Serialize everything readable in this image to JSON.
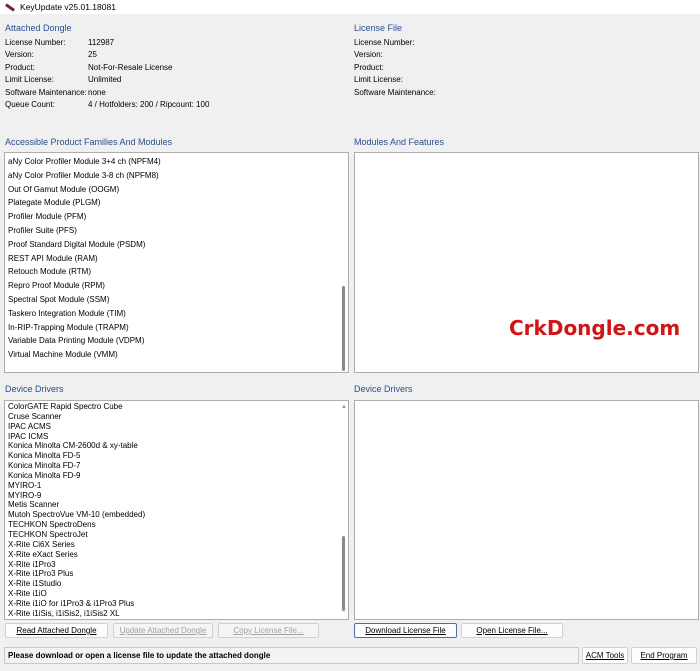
{
  "window": {
    "title": "KeyUpdate v25.01.18081"
  },
  "attached": {
    "heading": "Attached Dongle",
    "rows": [
      {
        "k": "License Number:",
        "v": "112987"
      },
      {
        "k": "Version:",
        "v": "25"
      },
      {
        "k": "Product:",
        "v": "Not-For-Resale License"
      },
      {
        "k": "Limit License:",
        "v": "Unlimited"
      },
      {
        "k": "Software Maintenance:",
        "v": "none"
      },
      {
        "k": "Queue Count:",
        "v": "4 / Hotfolders: 200 / Ripcount: 100"
      }
    ]
  },
  "license_file": {
    "heading": "License File",
    "rows": [
      {
        "k": "License Number:"
      },
      {
        "k": "Version:"
      },
      {
        "k": "Product:"
      },
      {
        "k": "Limit License:"
      },
      {
        "k": "Software Maintenance:"
      }
    ]
  },
  "modules": {
    "heading": "Accessible Product Families And Modules",
    "items": [
      "aNy Color Profiler Module 3+4 ch (NPFM4)",
      "aNy Color Profiler Module 3-8 ch (NPFM8)",
      "Out Of Gamut Module (OOGM)",
      "Plategate Module (PLGM)",
      "Profiler Module (PFM)",
      "Profiler Suite (PFS)",
      "Proof Standard Digital Module (PSDM)",
      "REST API Module (RAM)",
      "Retouch Module (RTM)",
      "Repro Proof Module (RPM)",
      "Spectral Spot Module (SSM)",
      "Taskero Integration Module (TIM)",
      "In-RIP-Trapping Module (TRAPM)",
      "Variable Data Printing Module (VDPM)",
      "Virtual Machine Module (VMM)"
    ]
  },
  "features": {
    "heading": "Modules And Features"
  },
  "drivers_left": {
    "heading": "Device Drivers",
    "items": [
      "ColorGATE Rapid Spectro Cube",
      "Cruse Scanner",
      "IPAC ACMS",
      "IPAC ICMS",
      "Konica Minolta CM-2600d & xy-table",
      "Konica Minolta FD-5",
      "Konica Minolta FD-7",
      "Konica Minolta FD-9",
      "MYIRO-1",
      "MYIRO-9",
      "Metis Scanner",
      "Mutoh SpectroVue VM-10 (embedded)",
      "TECHKON SpectroDens",
      "TECHKON SpectroJet",
      "X-Rite Ci6X Series",
      "X-Rite eXact Series",
      "X-Rite i1Pro3",
      "X-Rite i1Pro3 Plus",
      "X-Rite i1Studio",
      "X-Rite i1iO",
      "X-Rite i1iO for i1Pro3 & i1Pro3 Plus",
      "X-Rite i1iSis, i1iSis2, i1iSis2 XL"
    ]
  },
  "drivers_right": {
    "heading": "Device Drivers"
  },
  "buttons": {
    "read": "Read Attached Dongle",
    "update": "Update Attached Dongle",
    "copy": "Copy License File...",
    "download": "Download License File",
    "open": "Open License File...",
    "acm": "ACM Tools",
    "end": "End Program"
  },
  "status": "Please download or open a license file to update the attached dongle",
  "watermark": "CrkDongle.com",
  "colors": {
    "heading": "#2b4f8c",
    "watermark": "#d21414"
  }
}
